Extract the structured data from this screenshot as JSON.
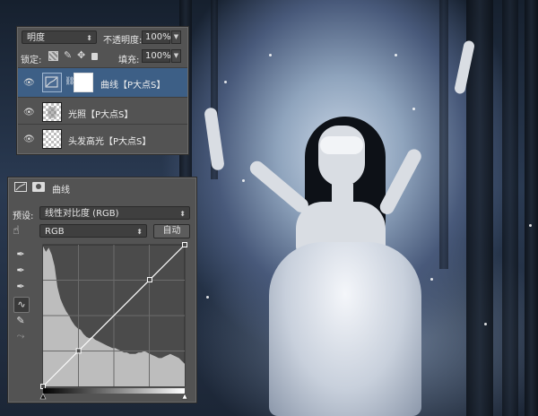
{
  "layers_panel": {
    "blend_mode": "明度",
    "opacity_label": "不透明度:",
    "opacity_value": "100%",
    "lock_label": "锁定:",
    "fill_label": "填充:",
    "fill_value": "100%",
    "layers": [
      {
        "name": "曲线【P大点S】",
        "visible": true,
        "selected": true
      },
      {
        "name": "光照【P大点S】",
        "visible": true,
        "selected": false
      },
      {
        "name": "头发高光【P大点S】",
        "visible": true,
        "selected": false
      }
    ]
  },
  "curves_panel": {
    "title": "曲线",
    "preset_label": "预设:",
    "preset_value": "线性对比度 (RGB)",
    "channel_value": "RGB",
    "auto_label": "自动",
    "tools": [
      "hand-target-icon",
      "eyedropper-black-icon",
      "eyedropper-gray-icon",
      "eyedropper-white-icon",
      "curve-edit-icon",
      "pencil-icon",
      "smooth-icon"
    ],
    "chart_data": {
      "type": "area",
      "description_points": [
        [
          0,
          0
        ],
        [
          64,
          64
        ],
        [
          192,
          192
        ],
        [
          255,
          255
        ]
      ],
      "xlim": [
        0,
        255
      ],
      "ylim": [
        0,
        255
      ],
      "grid": true,
      "histogram": [
        0.99,
        0.95,
        0.98,
        0.93,
        0.85,
        0.7,
        0.62,
        0.57,
        0.53,
        0.5,
        0.46,
        0.43,
        0.41,
        0.4,
        0.37,
        0.35,
        0.34,
        0.35,
        0.33,
        0.32,
        0.31,
        0.3,
        0.29,
        0.28,
        0.27,
        0.27,
        0.26,
        0.25,
        0.24,
        0.24,
        0.23,
        0.23,
        0.23,
        0.24,
        0.24,
        0.25,
        0.24,
        0.23,
        0.22,
        0.21,
        0.2,
        0.2,
        0.21,
        0.22,
        0.23,
        0.22,
        0.21,
        0.2,
        0.18,
        0.16
      ]
    }
  },
  "colors": {
    "panel_bg": "#535353",
    "selected_row": "#3d5f86",
    "curve_line": "#ffffff",
    "histogram_fill": "#bdbdbd",
    "graph_bg": "#4b4b4b"
  }
}
